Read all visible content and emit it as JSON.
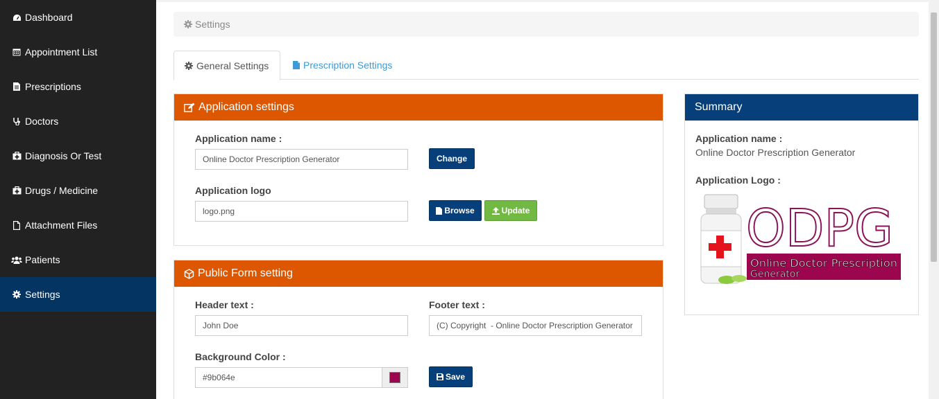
{
  "sidebar": {
    "items": [
      {
        "label": "Dashboard",
        "icon": "dashboard-icon"
      },
      {
        "label": "Appointment List",
        "icon": "calendar-icon"
      },
      {
        "label": "Prescriptions",
        "icon": "file-text-icon"
      },
      {
        "label": "Doctors",
        "icon": "stethoscope-icon"
      },
      {
        "label": "Diagnosis Or Test",
        "icon": "medkit-icon"
      },
      {
        "label": "Drugs / Medicine",
        "icon": "medkit-icon"
      },
      {
        "label": "Attachment Files",
        "icon": "file-icon"
      },
      {
        "label": "Patients",
        "icon": "users-icon"
      },
      {
        "label": "Settings",
        "icon": "gear-icon",
        "active": true
      }
    ]
  },
  "breadcrumb": {
    "label": "Settings"
  },
  "tabs": [
    {
      "label": "General Settings",
      "active": true
    },
    {
      "label": "Prescription Settings",
      "active": false
    }
  ],
  "app_settings": {
    "title": "Application settings",
    "name_label": "Application name :",
    "name_value": "Online Doctor Prescription Generator",
    "change_button": "Change",
    "logo_label": "Application logo",
    "logo_value": "logo.png",
    "browse_button": "Browse",
    "update_button": "Update"
  },
  "public_form": {
    "title": "Public Form setting",
    "header_label": "Header text :",
    "header_value": "John Doe",
    "footer_label": "Footer text :",
    "footer_value": "(C) Copyright  - Online Doctor Prescription Generator",
    "bg_label": "Background Color :",
    "bg_value": "#9b064e",
    "save_button": "Save"
  },
  "summary": {
    "title": "Summary",
    "name_label": "Application name :",
    "name_value": "Online Doctor Prescription Generator",
    "logo_label": "Application Logo :",
    "logo_text": "ODPG",
    "logo_subtitle_1": "Online Doctor Prescription",
    "logo_subtitle_2": "Generator"
  },
  "colors": {
    "sidebar_bg": "#222222",
    "sidebar_active": "#043461",
    "panel_orange": "#dd5600",
    "panel_navy": "#063f7a",
    "button_green": "#72b944",
    "brand_purple": "#9b064e"
  }
}
